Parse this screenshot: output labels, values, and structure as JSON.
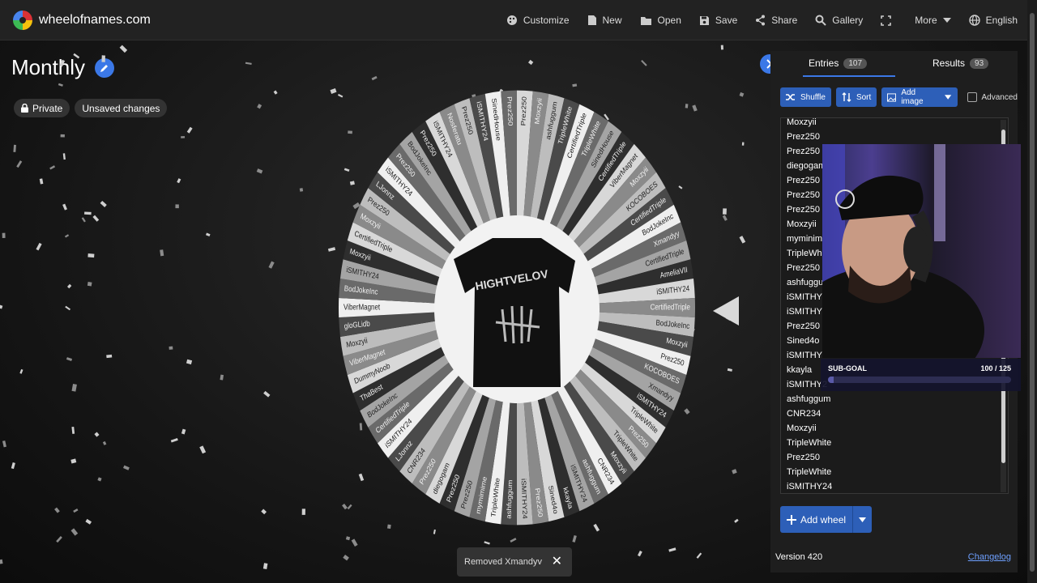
{
  "brand": {
    "name": "wheelofnames.com"
  },
  "menu": [
    {
      "label": "Customize",
      "icon": "palette-icon"
    },
    {
      "label": "New",
      "icon": "file-icon"
    },
    {
      "label": "Open",
      "icon": "folder-icon"
    },
    {
      "label": "Save",
      "icon": "save-icon"
    },
    {
      "label": "Share",
      "icon": "share-icon"
    },
    {
      "label": "Gallery",
      "icon": "search-icon"
    },
    {
      "label": "",
      "icon": "fullscreen-icon"
    },
    {
      "label": "More",
      "icon": "chevron-down-icon"
    },
    {
      "label": "English",
      "icon": "globe-icon"
    }
  ],
  "wheel_title": "Monthly",
  "chips": {
    "privacy": "Private",
    "status": "Unsaved changes"
  },
  "tabs": {
    "entries_label": "Entries",
    "entries_count": "107",
    "results_label": "Results",
    "results_count": "93"
  },
  "tools": {
    "shuffle": "Shuffle",
    "sort": "Sort",
    "add_image": "Add image",
    "advanced": "Advanced"
  },
  "entries": [
    "Moxzyii",
    "Prez250",
    "Prez250",
    "diegogam",
    "Prez250",
    "Prez250",
    "Prez250",
    "Moxzyii",
    "myminime",
    "TripleWhit",
    "Prez250",
    "ashfuggum",
    "iSMITHY24",
    "iSMITHY2",
    "Prez250",
    "Sined4o",
    "iSMITHY24",
    "kkayla",
    "iSMITHY2",
    "ashfuggum",
    "CNR234",
    "Moxzyii",
    "TripleWhite",
    "Prez250",
    "TripleWhite",
    "iSMITHY24"
  ],
  "wheel_segments": [
    "Prez250",
    "Moxzyii",
    "ashfuggum",
    "TripleWhite",
    "CertifiedTriple",
    "TripleWhite",
    "SinedHouse",
    "CertifiedTriple",
    "ViberMagnet",
    "Moxzyii",
    "KOCOBOES",
    "CertifiedTriple",
    "BodJokeInc",
    "Xmandyy",
    "CertifiedTriple",
    "AmeliaVII",
    "iSMITHY24",
    "CertifiedTriple",
    "BodJokeInc",
    "Moxzyii",
    "Prez250",
    "KOCOBOES",
    "Xmandyy",
    "iSMITHY24",
    "TripleWhite",
    "Prez250",
    "TripleWhite",
    "Moxzyii",
    "CNR234",
    "ashfuggum",
    "iSMITHY24",
    "kkayla",
    "Sined4o",
    "Prez250",
    "iSMITHY24",
    "ashfuggum",
    "TripleWhite",
    "mymimime",
    "Prez250",
    "Prez250",
    "diegogam",
    "Prez250",
    "CNR234",
    "LJonnz",
    "iSMITHY24",
    "CertifiedTriple",
    "BodJokeInc",
    "ThaBest",
    "DummyNoob",
    "ViberMagnet",
    "Moxzyii",
    "gloGLidb",
    "ViberMagnet",
    "BodJokeInc",
    "iSMITHY24",
    "Moxzyii",
    "CertifiedTriple",
    "Moxzyii",
    "Prez250",
    "LJonnz",
    "iSMITHY24",
    "Prez250",
    "BodJokeInc",
    "Prez250",
    "iSMITHY24",
    "Nosferatu",
    "Prez250",
    "iSMITHY24",
    "SinedHouse",
    "Prez250"
  ],
  "wheel_center_text": "HIGHTVELOV",
  "toast": {
    "message": "Removed Xmandyv"
  },
  "add_wheel": "Add wheel",
  "version": "Version 420",
  "changelog": "Changelog",
  "sub_goal": {
    "label": "SUB-GOAL",
    "count": "100 / 125",
    "progress": 0.8
  },
  "colors": {
    "accent": "#3b78e7",
    "panel": "#1e1e1e",
    "topbar": "#222222"
  }
}
